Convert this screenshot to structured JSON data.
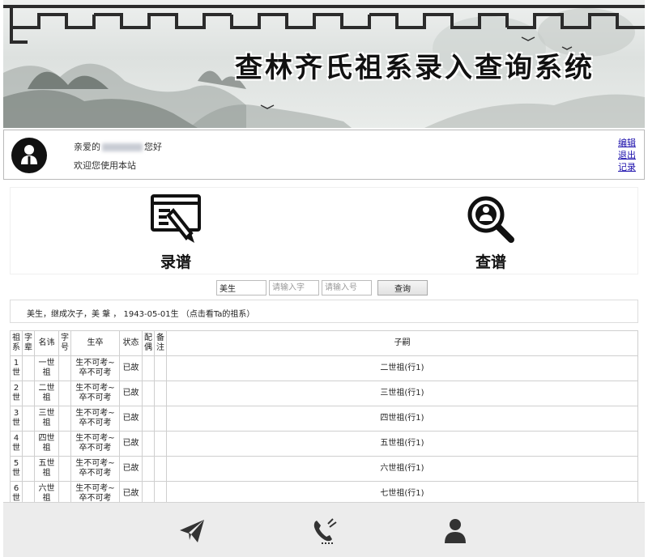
{
  "banner": {
    "title": "查林齐氏祖系录入查询系统"
  },
  "user": {
    "greeting_prefix": "亲爱的",
    "greeting_suffix": "您好",
    "welcome": "欢迎您使用本站",
    "links": [
      "编辑",
      "退出",
      "记录"
    ]
  },
  "actions": {
    "record_label": "录谱",
    "query_label": "查谱"
  },
  "search": {
    "name_value": "美生",
    "zi_placeholder": "请输入字",
    "hao_placeholder": "请输入号",
    "button_label": "查询"
  },
  "info": {
    "text": "美生，继成次子，美 鞶 ，  1943-05-01生 （点击看Ta的祖系）"
  },
  "table": {
    "headers": [
      "祖系",
      "字辈",
      "名讳",
      "字号",
      "生卒",
      "状态",
      "配偶",
      "备注",
      "子嗣"
    ],
    "rows": [
      [
        "1世",
        "",
        "一世祖",
        "",
        "生不可考~卒不可考",
        "已故",
        "",
        "",
        "二世祖(行1)"
      ],
      [
        "2世",
        "",
        "二世祖",
        "",
        "生不可考~卒不可考",
        "已故",
        "",
        "",
        "三世祖(行1)"
      ],
      [
        "3世",
        "",
        "三世祖",
        "",
        "生不可考~卒不可考",
        "已故",
        "",
        "",
        "四世祖(行1)"
      ],
      [
        "4世",
        "",
        "四世祖",
        "",
        "生不可考~卒不可考",
        "已故",
        "",
        "",
        "五世祖(行1)"
      ],
      [
        "5世",
        "",
        "五世祖",
        "",
        "生不可考~卒不可考",
        "已故",
        "",
        "",
        "六世祖(行1)"
      ],
      [
        "6世",
        "",
        "六世祖",
        "",
        "生不可考~卒不可考",
        "已故",
        "",
        "",
        "七世祖(行1)"
      ]
    ]
  },
  "footer": {
    "icons": [
      "send-icon",
      "phone-icon",
      "user-icon"
    ]
  },
  "colors": {
    "footer_bg": "#ececec",
    "link": "#1a0dab",
    "text": "#222222"
  }
}
